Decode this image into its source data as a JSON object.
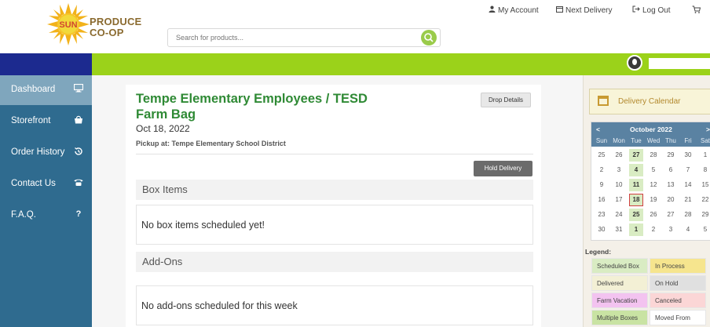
{
  "header": {
    "logo_sun_text": "SUN",
    "logo_line1": "PRODUCE",
    "logo_line2": "CO-OP",
    "search_placeholder": "Search for products...",
    "links": [
      {
        "icon": "user-icon",
        "label": "My Account"
      },
      {
        "icon": "calendar-icon",
        "label": "Next Delivery"
      },
      {
        "icon": "logout-icon",
        "label": "Log Out"
      },
      {
        "icon": "cart-icon",
        "label": ""
      }
    ]
  },
  "sidebar": {
    "items": [
      {
        "label": "Dashboard",
        "icon": "monitor-icon",
        "active": true
      },
      {
        "label": "Storefront",
        "icon": "shopping-bag-icon",
        "active": false
      },
      {
        "label": "Order History",
        "icon": "history-icon",
        "active": false
      },
      {
        "label": "Contact Us",
        "icon": "phone-icon",
        "active": false
      },
      {
        "label": "F.A.Q.",
        "icon": "question-icon",
        "active": false
      }
    ]
  },
  "main": {
    "title": "Tempe Elementary Employees / TESD Farm Bag",
    "date": "Oct 18, 2022",
    "pickup": "Pickup at: Tempe Elementary School District",
    "drop_button": "Drop Details",
    "hold_button": "Hold Delivery",
    "box_items": {
      "heading": "Box Items",
      "empty": "No box items scheduled yet!"
    },
    "add_ons": {
      "heading": "Add-Ons",
      "empty": "No add-ons scheduled for this week"
    }
  },
  "calendar": {
    "title": "Delivery Calendar",
    "month": "October 2022",
    "prev": "<",
    "next": ">",
    "weekdays": [
      "Sun",
      "Mon",
      "Tue",
      "Wed",
      "Thu",
      "Fri",
      "Sat"
    ],
    "weeks": [
      [
        "25",
        "26",
        "27",
        "28",
        "29",
        "30",
        "1"
      ],
      [
        "2",
        "3",
        "4",
        "5",
        "6",
        "7",
        "8"
      ],
      [
        "9",
        "10",
        "11",
        "12",
        "13",
        "14",
        "15"
      ],
      [
        "16",
        "17",
        "18",
        "19",
        "20",
        "21",
        "22"
      ],
      [
        "23",
        "24",
        "25",
        "26",
        "27",
        "28",
        "29"
      ],
      [
        "30",
        "31",
        "1",
        "2",
        "3",
        "4",
        "5"
      ]
    ],
    "scheduled_days": [
      "27",
      "4",
      "11",
      "18",
      "25",
      "1"
    ],
    "selected_day": "18"
  },
  "legend": {
    "title": "Legend:",
    "items": [
      {
        "label": "Scheduled Box",
        "color": "#d9ecc3"
      },
      {
        "label": "In Process",
        "color": "#f6e58e"
      },
      {
        "label": "Delivered",
        "color": "#f3f0d5"
      },
      {
        "label": "On Hold",
        "color": "#e0e0e0"
      },
      {
        "label": "Farm Vacation",
        "color": "#f3c3f0"
      },
      {
        "label": "Canceled",
        "color": "#fbd6d6"
      },
      {
        "label": "Multiple Boxes",
        "color": "#c9e3a3"
      },
      {
        "label": "Moved From",
        "color": "#ffffff"
      }
    ]
  },
  "colors": {
    "top_bar_left": "#1c2a8f",
    "top_bar_green": "#9bd21a",
    "sidebar": "#2f6b8f",
    "title_green": "#2f8a35"
  }
}
